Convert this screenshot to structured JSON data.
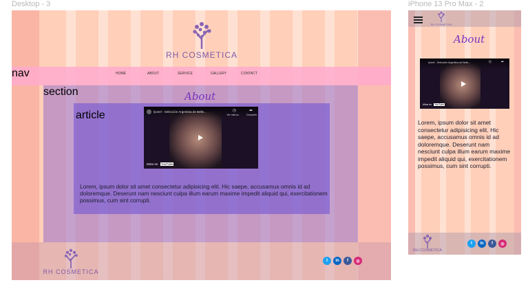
{
  "frames": {
    "desktop_label": "Desktop - 3",
    "mobile_label": "iPhone 13 Pro Max - 2"
  },
  "brand": {
    "name": "RH COSMETICA",
    "icon": "tree-logo-icon"
  },
  "nav": {
    "overlay_label": "nav",
    "items": [
      "HOME",
      "ABOUT",
      "SERVICE",
      "GALLERY",
      "CONTACT"
    ]
  },
  "section": {
    "overlay_label": "section"
  },
  "article": {
    "overlay_label": "article"
  },
  "content": {
    "heading": "About",
    "paragraph": "Lorem, ipsum dolor sit amet consectetur adipisicing elit. Hic saepe, accusamus omnis id ad doloremque. Deserunt nam nesciunt culpa illum earum maxime impedit aliquid qui, exercitationem  possimus, cum sint corrupti.",
    "mobile_paragraph": "Lorem, ipsum dolor sit amet consectetur adipisicing elit. Hic saepe, accusamus omnis id ad doloremque. Deserunt nam nesciunt culpa illum earum maxime impedit aliquid qui, exercitationem  possimus, cum sint corrupti."
  },
  "video": {
    "title": "lyoeel - Selección Argentina de Belle...",
    "watch_later": "Ver más ta...",
    "share": "Compartir",
    "watch_on": "Mirar en",
    "platform": "YouTube"
  },
  "social": [
    {
      "icon": "twitter-icon",
      "glyph": "t",
      "color": "#1da1f2"
    },
    {
      "icon": "linkedin-icon",
      "glyph": "in",
      "color": "#0a66c2"
    },
    {
      "icon": "facebook-icon",
      "glyph": "f",
      "color": "#3b5998"
    },
    {
      "icon": "instagram-icon",
      "glyph": "◎",
      "color": "#d62976"
    }
  ],
  "colors": {
    "grid": "#ffd3c0",
    "nav": "#ffaacd",
    "section": "#9a6fd0",
    "heading": "#7a33c0",
    "logo_text": "#7f5aa8"
  }
}
